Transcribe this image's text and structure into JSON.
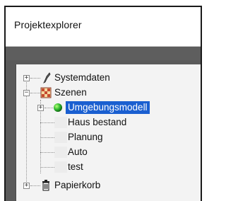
{
  "panel": {
    "title": "Projektexplorer"
  },
  "tree": {
    "items": [
      {
        "label": "Systemdaten",
        "icon": "wrench-icon"
      },
      {
        "label": "Szenen",
        "icon": "scene-grid-icon"
      },
      {
        "label": "Umgebungsmodell",
        "icon": "green-sphere-icon",
        "selected": true
      },
      {
        "label": "Haus bestand"
      },
      {
        "label": "Planung"
      },
      {
        "label": "Auto"
      },
      {
        "label": "test"
      },
      {
        "label": "Papierkorb",
        "icon": "trash-icon"
      }
    ]
  },
  "colors": {
    "selection": "#1a5fd0",
    "panel_bg": "#5a5a5a",
    "tree_bg": "#f3f3f3"
  }
}
